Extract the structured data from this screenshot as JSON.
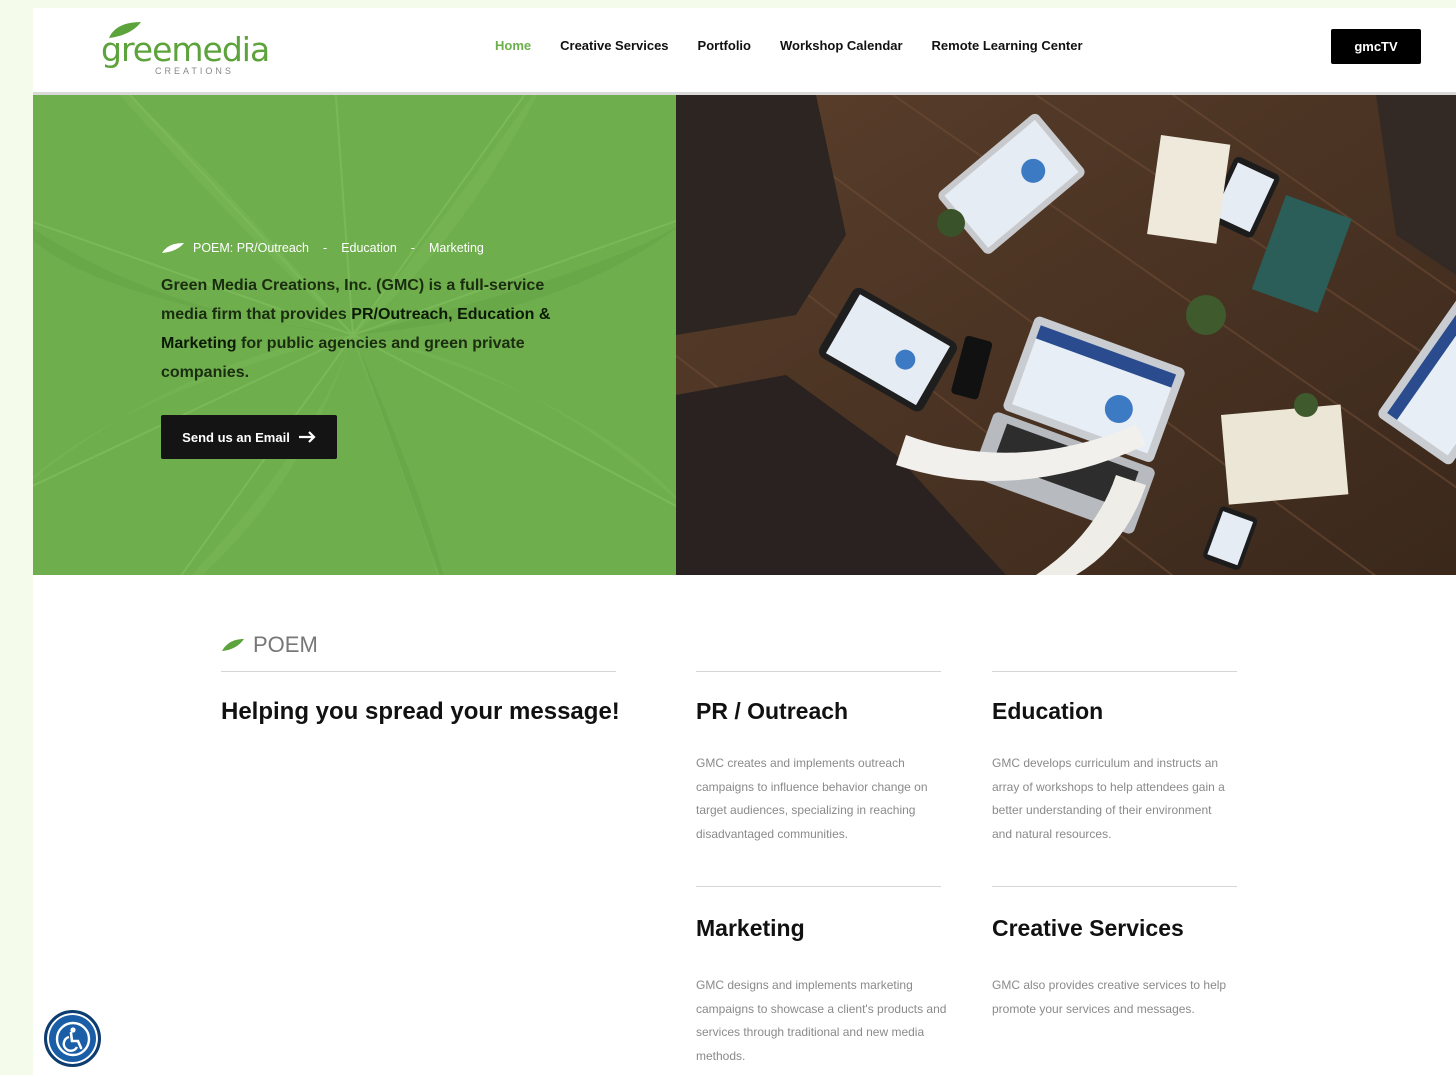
{
  "brand": {
    "logo_text": "greemedia",
    "logo_sub": "CREATIONS",
    "accent_color": "#6bb04a",
    "hero_green": "#6fae4d"
  },
  "nav": {
    "items": [
      {
        "label": "Home",
        "active": true
      },
      {
        "label": "Creative Services",
        "active": false
      },
      {
        "label": "Portfolio",
        "active": false
      },
      {
        "label": "Workshop Calendar",
        "active": false
      },
      {
        "label": "Remote Learning Center",
        "active": false
      }
    ],
    "cta_label": "gmcTV"
  },
  "hero": {
    "tag_parts": [
      "POEM: PR/Outreach",
      "-",
      "Education",
      "-",
      "Marketing"
    ],
    "text_1": "Green Media Creations, Inc. (GMC) is a full-service media firm that provides ",
    "text_bold_1": "PR/Outreach, Education & Marketing",
    "text_2": " for public agencies and green private companies.",
    "button_label": "Send us an Email",
    "image_icon": "office-meeting-photo"
  },
  "content": {
    "section_label": "POEM",
    "heading": "Helping you spread your message!",
    "services": [
      {
        "title": "PR / Outreach",
        "desc": "GMC creates and implements outreach campaigns to influence behavior change on target audiences, specializing in reaching disadvantaged communities."
      },
      {
        "title": "Education",
        "desc": "GMC develops curriculum and instructs an array of workshops to help attendees gain a better understanding of their environment and natural resources."
      },
      {
        "title": "Marketing",
        "desc": "GMC designs and implements marketing campaigns to showcase a client's products and services through traditional and new media methods."
      },
      {
        "title": "Creative Services",
        "desc": "GMC also provides creative services to help promote your services and messages."
      }
    ]
  },
  "accessibility": {
    "icon": "accessibility-icon"
  }
}
